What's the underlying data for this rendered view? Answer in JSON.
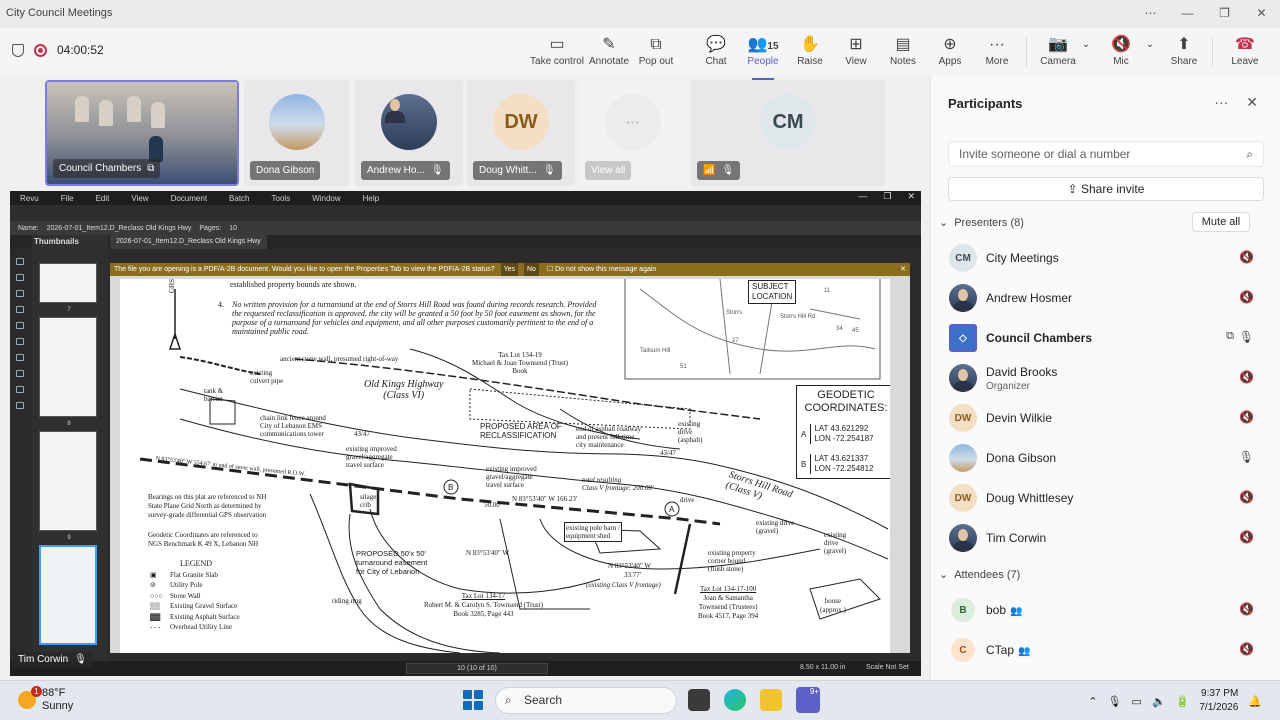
{
  "window": {
    "title": "City Council Meetings",
    "controls": [
      "⋯",
      "—",
      "❐",
      "✕"
    ]
  },
  "meeting": {
    "duration": "04:00:52"
  },
  "toolbar": {
    "take_control": "Take control",
    "annotate": "Annotate",
    "pop_out": "Pop out",
    "chat": "Chat",
    "people": "People",
    "people_count": "15",
    "raise": "Raise",
    "view": "View",
    "notes": "Notes",
    "apps": "Apps",
    "more": "More",
    "camera": "Camera",
    "mic": "Mic",
    "share": "Share",
    "leave": "Leave"
  },
  "gallery": [
    {
      "name": "Council Chambers"
    },
    {
      "name": "Dona Gibson"
    },
    {
      "name": "Andrew Ho..."
    },
    {
      "name": "Doug Whitt...",
      "initials": "DW"
    },
    {
      "name": "View all",
      "initials": "···"
    },
    {
      "initials": "CM"
    }
  ],
  "revu": {
    "menu": [
      "Revu",
      "File",
      "Edit",
      "View",
      "Document",
      "Batch",
      "Tools",
      "Window",
      "Help"
    ],
    "doc_name_label": "Name:",
    "doc_name": "2026-07-01_Item12.D_Reclass Old Kings Hwy",
    "pages_label": "Pages:",
    "pages": "10",
    "thumbnails_label": "Thumbnails",
    "tab": "2026-07-01_Item12.D_Reclass Old Kings Hwy",
    "notice": "The file you are opening is a PDF/A-2B document. Would you like to open the Properties Tab to view the PDF/A-2B status?",
    "notice_yes": "Yes",
    "notice_no": "No",
    "notice_dont_show": "Do not show this message again",
    "thumb_numbers": [
      "7",
      "8",
      "9"
    ],
    "page_indicator": "10 (10 of 10)",
    "page_size": "8.50 x 11.00 in",
    "scale": "Scale Not Set"
  },
  "plat": {
    "note1": "established property bounds are shown.",
    "note4_num": "4.",
    "note4_lines": [
      "No written provision for a turnaround at the end of Storrs Hill Road was found during records research. Provided",
      "the requested reclassification is approved, the city will be granted a 50 foot by 50 foot easement as shown, for the",
      "purpose of a turnaround for vehicles and equipment, and all other purposes customarily pertinent to the end of a",
      "maintained public road."
    ],
    "subject_location": [
      "SUBJECT",
      "LOCATION"
    ],
    "north": "GHS",
    "tax_lot_top": [
      "Tax Lot 134-19",
      "Michael & Joan Townsend (Trust)",
      "Book"
    ],
    "stone_wall": "ancient stone wall, presumed right-of-way",
    "culvert": [
      "existing",
      "culvert pipe"
    ],
    "old_kings": [
      "Old Kings Highway",
      "(Class VI)"
    ],
    "tank": [
      "tank &",
      "barrier"
    ],
    "fence": [
      "chain link fence around",
      "City of Lebanon EMS",
      "communications tower"
    ],
    "num_43_47": "43/47",
    "improved1": [
      "existing improved",
      "gravel/aggregate",
      "travel surface"
    ],
    "proposed_area": [
      "PROPOSED AREA OF",
      "RECLASSIFICATION"
    ],
    "end_asphalt": [
      "end of asphalt roadway",
      "and present full-time",
      "city maintenance"
    ],
    "exist_drive1": [
      "existing",
      "drive",
      "(asphalt)"
    ],
    "bearing_stone": "N 83°53'40\" W  554.67' to end of stone wall, presumed R.O.W.",
    "bearings_note": [
      "Bearings on this plat are referenced to NH",
      "State Plane Grid North as determined by",
      "survey-grade differential GPS observation"
    ],
    "geodetic_note": [
      "Geodetic Coordinates are referenced to",
      "NGS Benchmark K 49 X, Lebanon NH"
    ],
    "silage": [
      "silage",
      "crib"
    ],
    "improved2": [
      "existing improved",
      "gravel/aggregate",
      "travel surface"
    ],
    "total_frontage": [
      "total resulting",
      "Class V frontage: 200.00'"
    ],
    "bearing_mid": "N 83°53'40\" W  166.23'",
    "drive": "drive",
    "storrs": [
      "Storrs Hill Road",
      "(Class V)"
    ],
    "dist_50": "50.00'",
    "pole_barn": [
      "existing pole barn /",
      "equipment shed"
    ],
    "exist_drive2": [
      "existing drive",
      "(gravel)"
    ],
    "exist_drive3": [
      "existing",
      "drive",
      "(gravel)"
    ],
    "proposed_50": [
      "PROPOSED 50'x 50'",
      "turnaround easement",
      "for City of Lebanon"
    ],
    "bearing_low1": "N 83°53'40\" W",
    "bearing_low2": "N 83°53'40\" W",
    "dist_33": "33.77'",
    "existing_class_v": "(existing Class V frontage)",
    "corner_bound": [
      "existing property",
      "corner bound",
      "(flush stone)"
    ],
    "legend_title": "LEGEND",
    "legend_items": [
      "Flat Granite Slab",
      "Utility Pole",
      "Stone Wall",
      "Existing Gravel Surface",
      "Existing Asphalt Surface",
      "Overhead Utility Line"
    ],
    "riding_ring": "riding ring",
    "tax_lot_137": [
      "Tax Lot 134-17",
      "Robert M. & Carolyn S. Townsend (Trust)",
      "Book 3285, Page 443"
    ],
    "tax_lot_100": [
      "Tax Lot 134-17-100",
      "Joan & Samantha",
      "Townsend (Trustees)",
      "Book 4517, Page 394"
    ],
    "house": [
      "house",
      "(approx.)"
    ],
    "geodetic": {
      "title": [
        "GEODETIC",
        "COORDINATES:"
      ],
      "a_label": "A",
      "a_lat": "LAT 43.621292",
      "a_lon": "LON -72.254187",
      "b_label": "B",
      "b_lat": "LAT 43.621337",
      "b_lon": "LON -72.254812"
    },
    "point_a": "A",
    "point_b": "B",
    "map_labels": [
      "Storrs Hill Rd",
      "Tailsum Hill",
      "Storrs",
      "51",
      "27",
      "11",
      "34",
      "45"
    ]
  },
  "shared_presenter": {
    "name": "Tim Corwin"
  },
  "panel": {
    "title": "Participants",
    "invite_placeholder": "Invite someone or dial a number",
    "share_invite": "Share invite",
    "presenters_label": "Presenters (8)",
    "mute_all": "Mute all",
    "attendees_label": "Attendees (7)",
    "presenters": [
      {
        "name": "City Meetings",
        "initials": "CM"
      },
      {
        "name": "Andrew Hosmer"
      },
      {
        "name": "Council Chambers"
      },
      {
        "name": "David Brooks",
        "role": "Organizer"
      },
      {
        "name": "Devin Wilkie",
        "initials": "DW"
      },
      {
        "name": "Dona Gibson"
      },
      {
        "name": "Doug Whittlesey",
        "initials": "DW"
      },
      {
        "name": "Tim Corwin"
      }
    ],
    "attendees": [
      {
        "name": "bob",
        "initials": "B"
      },
      {
        "name": "CTap",
        "initials": "C"
      }
    ]
  },
  "taskbar": {
    "weather_badge": "1",
    "temperature": "88°F",
    "condition": "Sunny",
    "search": "Search",
    "teams_badge": "9+",
    "time": "9:37 PM",
    "date": "7/1/2026"
  }
}
